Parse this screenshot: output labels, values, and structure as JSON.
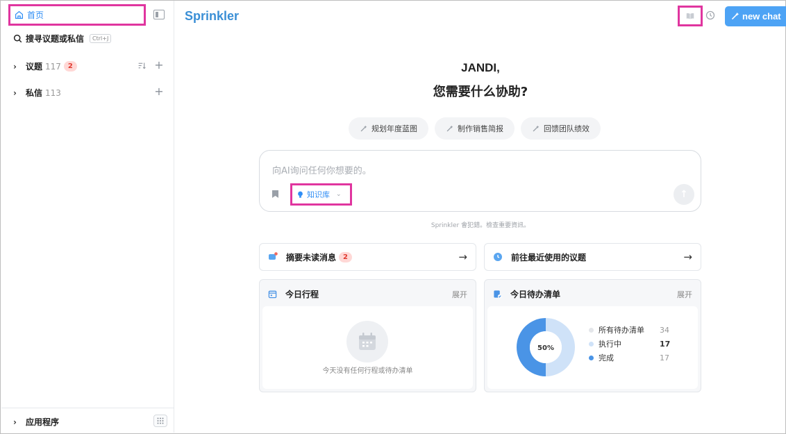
{
  "sidebar": {
    "home_label": "首页",
    "search_label": "搜寻议题或私信",
    "search_shortcut": "Ctrl+J",
    "topics": {
      "label": "议题",
      "count": "117",
      "badge": "2"
    },
    "dms": {
      "label": "私信",
      "count": "113"
    },
    "apps_label": "应用程序"
  },
  "header": {
    "brand": "Sprinkler",
    "new_chat_label": "new chat"
  },
  "main": {
    "greeting_name": "JANDI,",
    "greeting_question": "您需要什么协助?",
    "suggestions": [
      "规划年度蓝图",
      "制作销售简报",
      "回馈团队绩效"
    ],
    "input_placeholder": "向AI询问任何你想要的。",
    "knowledge_base_label": "知识库",
    "disclaimer": "Sprinkler 會犯錯。檢查重要資訊。",
    "shortcuts": [
      {
        "label": "摘要未读消息",
        "badge": "2"
      },
      {
        "label": "前往最近使用的议题"
      }
    ],
    "schedule_widget": {
      "title": "今日行程",
      "expand_label": "展开",
      "empty_text": "今天没有任何行程或待办清单"
    },
    "todo_widget": {
      "title": "今日待办清单",
      "expand_label": "展开",
      "percent_label": "50%",
      "legend": [
        {
          "label": "所有待办清单",
          "value": "34",
          "color": "#e4e6ea"
        },
        {
          "label": "执行中",
          "value": "17",
          "color": "#cfe2f8"
        },
        {
          "label": "完成",
          "value": "17",
          "color": "#4a94e6"
        }
      ]
    }
  },
  "colors": {
    "accent": "#4da3f5",
    "highlight_border": "#e0359f",
    "brand": "#3a8fd6"
  }
}
